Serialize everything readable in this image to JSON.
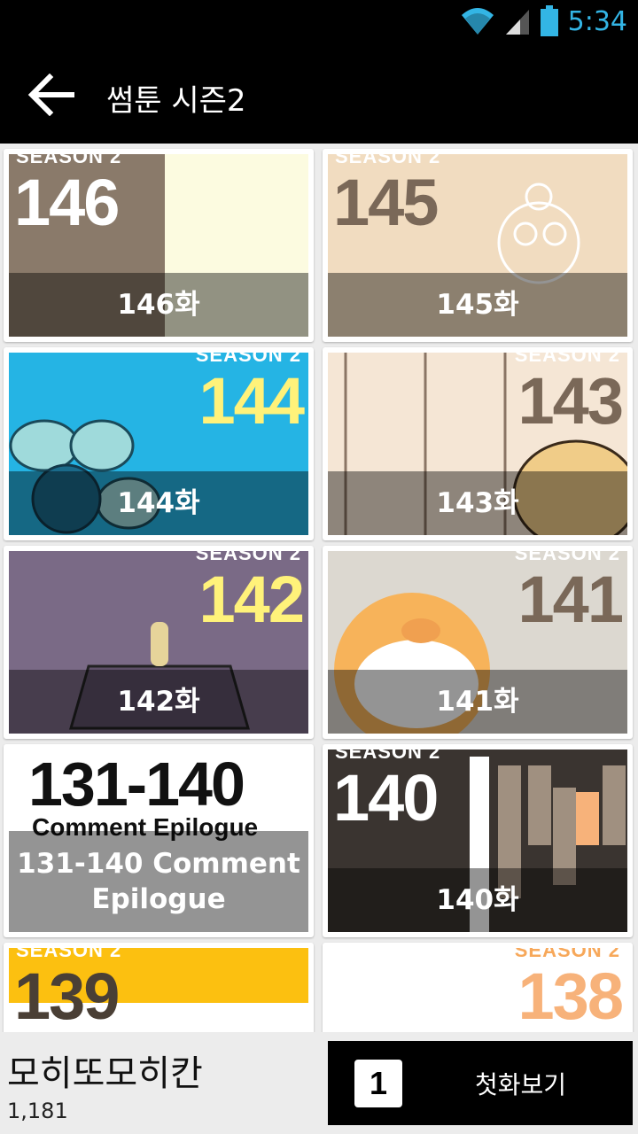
{
  "status_bar": {
    "time": "5:34",
    "icons": [
      "wifi-icon",
      "signal-icon",
      "battery-icon"
    ],
    "accent_color": "#33b5e5"
  },
  "app_bar": {
    "back_icon": "arrow-left-icon",
    "title": "썸툰 시즌2"
  },
  "episodes": [
    {
      "caption": "146화",
      "thumb_number": "146",
      "thumb_season": "SEASON 2"
    },
    {
      "caption": "145화",
      "thumb_number": "145",
      "thumb_season": "SEASON 2"
    },
    {
      "caption": "144화",
      "thumb_number": "144",
      "thumb_season": "SEASON 2"
    },
    {
      "caption": "143화",
      "thumb_number": "143",
      "thumb_season": "SEASON 2"
    },
    {
      "caption": "142화",
      "thumb_number": "142",
      "thumb_season": "SEASON 2"
    },
    {
      "caption": "141화",
      "thumb_number": "141",
      "thumb_season": "SEASON 2"
    },
    {
      "caption": "131-140 Comment Epilogue",
      "thumb_number": "131-140",
      "thumb_subtitle": "Comment Epilogue"
    },
    {
      "caption": "140화",
      "thumb_number": "140",
      "thumb_season": "SEASON 2"
    },
    {
      "caption": "",
      "thumb_number": "139",
      "thumb_season": "SEASON 2"
    },
    {
      "caption": "",
      "thumb_number": "138",
      "thumb_season": "SEASON 2"
    }
  ],
  "bottom_bar": {
    "author": "모히또모히칸",
    "count": "1,181",
    "first_episode_badge": "1",
    "first_episode_label": "첫화보기"
  }
}
